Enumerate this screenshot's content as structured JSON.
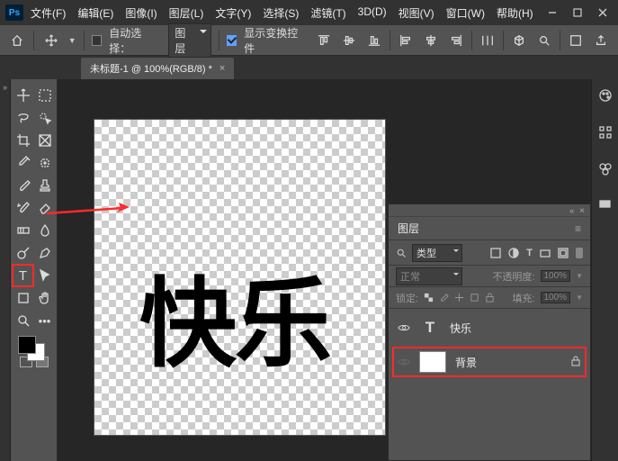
{
  "app_badge": "Ps",
  "menu": {
    "file": "文件(F)",
    "edit": "编辑(E)",
    "image": "图像(I)",
    "layer": "图层(L)",
    "type": "文字(Y)",
    "select": "选择(S)",
    "filter": "滤镜(T)",
    "threeD": "3D(D)",
    "view": "视图(V)",
    "window": "窗口(W)",
    "help": "帮助(H)"
  },
  "optbar": {
    "auto_select": "自动选择：",
    "auto_select_mode": "图层",
    "show_controls": "显示变换控件"
  },
  "doc": {
    "tab_label": "未标题-1 @ 100%(RGB/8) *",
    "canvas_text": "快乐"
  },
  "panel": {
    "title": "图层",
    "filter_label": "类型",
    "blend_mode": "正常",
    "opacity_label": "不透明度:",
    "opacity_value": "100%",
    "lock_label": "锁定:",
    "fill_label": "填充:",
    "fill_value": "100%",
    "layers": [
      {
        "name": "快乐",
        "kind": "text"
      },
      {
        "name": "背景",
        "kind": "bg"
      }
    ]
  }
}
